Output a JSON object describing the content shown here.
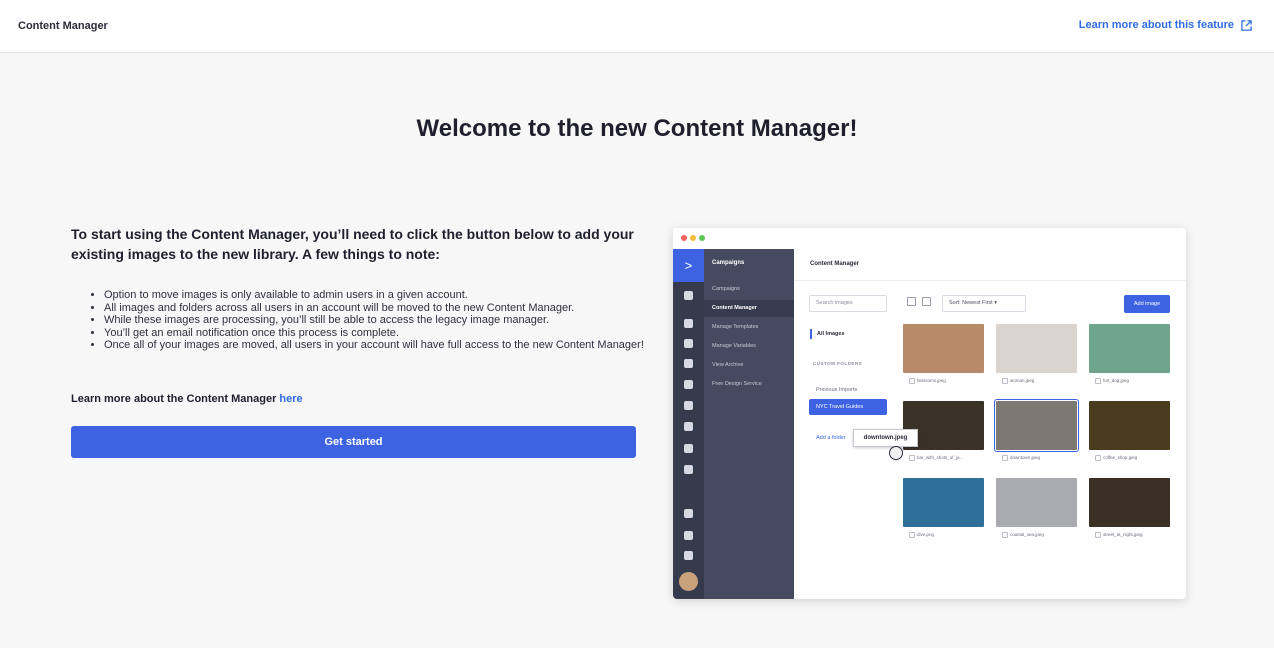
{
  "topbar": {
    "title": "Content Manager",
    "learn_more": "Learn more about this feature",
    "learn_more_icon": "external-link-icon"
  },
  "main": {
    "heading": "Welcome to the new Content Manager!",
    "intro": "To start using the Content Manager, you’ll need to click the button below to add your existing images to the new library. A few things to note:",
    "notes": [
      "Option to move images is only available to admin users in a given account.",
      "All images and folders across all users in an account will be moved to the new Content Manager.",
      "While these images are processing, you’ll still be able to access the legacy image manager.",
      "You’ll get an email notification once this process is complete.",
      "Once all of your images are moved, all users in your account will have full access to the new Content Manager!"
    ],
    "more_prefix": "Learn more about the Content Manager ",
    "more_link": "here",
    "button": "Get started"
  },
  "preview": {
    "rail_logo": ">",
    "nav_head": "Campaigns",
    "nav_items": [
      "Campaigns",
      "Content Manager",
      "Manage Templates",
      "Manage Variables",
      "View Archive",
      "Free Design Service"
    ],
    "main_title": "Content Manager",
    "search_placeholder": "Search images",
    "sort_label": "Sort:  Newest First  ▾",
    "add_button": "Add image",
    "all_images": "All Images",
    "custom_folders": "CUSTOM FOLDERS",
    "folders": [
      "Previous Imports",
      "NYC Travel Guides"
    ],
    "add_folder": "Add a folder",
    "drag_label": "downtown.jpeg",
    "images": [
      {
        "name": "blossoms.jpeg",
        "color": "#b98a6a"
      },
      {
        "name": "woman.jpeg",
        "color": "#d9d4d0"
      },
      {
        "name": "hot_dog.jpeg",
        "color": "#6fa58c"
      },
      {
        "name": "bar_with_shots_of_ja...",
        "color": "#3a3226"
      },
      {
        "name": "downtown.jpeg",
        "color": "#7d7872"
      },
      {
        "name": "coffee_shop.jpeg",
        "color": "#4a3a1e"
      },
      {
        "name": "dive.png",
        "color": "#2f6f99"
      },
      {
        "name": "coastal_sea.jpeg",
        "color": "#a9abae"
      },
      {
        "name": "street_at_night.jpeg",
        "color": "#3b3024"
      }
    ],
    "colors": {
      "accent": "#3d63e3",
      "rail": "#363a4d",
      "nav": "#454a60"
    }
  }
}
